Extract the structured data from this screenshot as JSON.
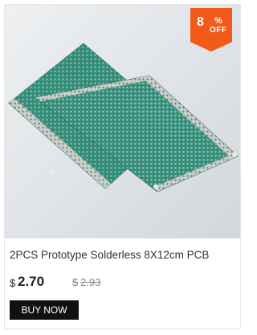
{
  "product": {
    "title": "2PCS Prototype Solderless 8X12cm PCB",
    "badge": {
      "number": "8",
      "percent": "%",
      "off": "OFF"
    },
    "price": {
      "currency": "$",
      "current": "2.70",
      "old_currency": "$",
      "old": "2.93"
    },
    "buy_button": "BUY NOW"
  },
  "colors": {
    "badge": "#f25a18",
    "board": "#2f8f7a",
    "button": "#111111"
  }
}
